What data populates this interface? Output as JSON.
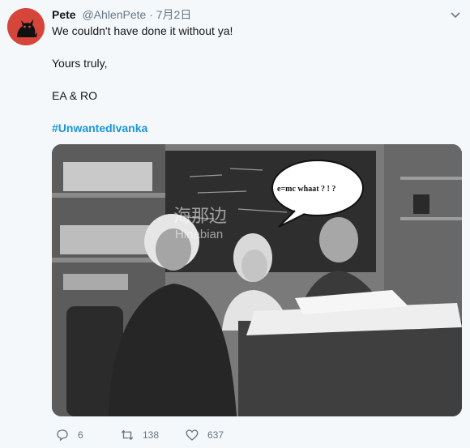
{
  "tweet": {
    "display_name": "Pete",
    "handle": "@AhlenPete",
    "separator": "·",
    "date": "7月2日",
    "lines": [
      "We couldn't have done it without ya!",
      "Yours truly,",
      "EA & RO"
    ],
    "hashtag": "#UnwantedIvanka"
  },
  "media": {
    "bubble_text": "e=mc  whaat ? ! ?",
    "watermark_cn": "海那边",
    "watermark_en": "Hinabian"
  },
  "actions": {
    "reply_count": "6",
    "retweet_count": "138",
    "like_count": "637"
  },
  "colors": {
    "link": "#1b95e0",
    "secondary": "#657786",
    "avatar_bg": "#d6453a"
  }
}
